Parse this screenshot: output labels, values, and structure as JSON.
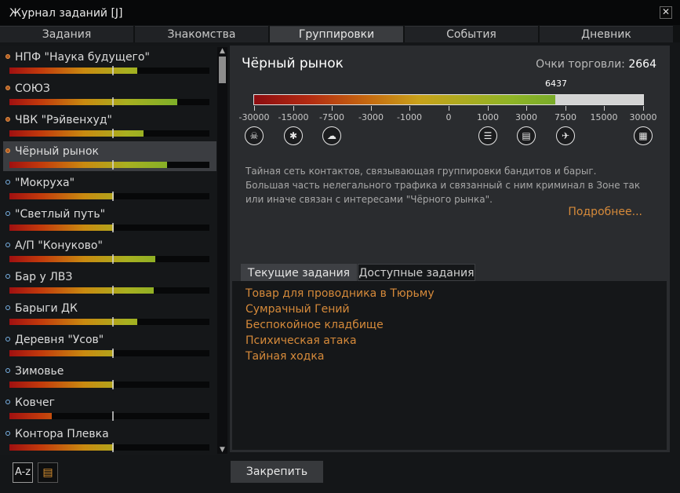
{
  "window": {
    "title": "Журнал заданий [J]",
    "close_icon": "✕"
  },
  "tabs": [
    "Задания",
    "Знакомства",
    "Группировки",
    "События",
    "Дневник"
  ],
  "active_tab": 2,
  "factions": [
    {
      "name": "НПФ \"Наука будущего\"",
      "relation": "hostile",
      "rep_fraction": 0.64
    },
    {
      "name": "СОЮЗ",
      "relation": "hostile",
      "rep_fraction": 0.84
    },
    {
      "name": "ЧВК \"Рэйвенхуд\"",
      "relation": "hostile",
      "rep_fraction": 0.67
    },
    {
      "name": "Чёрный рынок",
      "relation": "hostile",
      "rep_fraction": 0.79,
      "selected": true
    },
    {
      "name": "\"Мокруха\"",
      "relation": "neutral",
      "rep_fraction": 0.52
    },
    {
      "name": "\"Светлый путь\"",
      "relation": "neutral",
      "rep_fraction": 0.52
    },
    {
      "name": "А/П \"Конуково\"",
      "relation": "neutral",
      "rep_fraction": 0.73
    },
    {
      "name": "Бар у ЛВЗ",
      "relation": "neutral",
      "rep_fraction": 0.72
    },
    {
      "name": "Барыги ДК",
      "relation": "neutral",
      "rep_fraction": 0.64
    },
    {
      "name": "Деревня \"Усов\"",
      "relation": "neutral",
      "rep_fraction": 0.52
    },
    {
      "name": "Зимовье",
      "relation": "neutral",
      "rep_fraction": 0.52
    },
    {
      "name": "Ковчег",
      "relation": "neutral",
      "rep_fraction": 0.21
    },
    {
      "name": "Контора Плевка",
      "relation": "neutral",
      "rep_fraction": 0.52
    }
  ],
  "detail": {
    "title": "Чёрный рынок",
    "trade_label": "Очки торговли:",
    "trade_points": "2664",
    "rep_value": "6437",
    "rep_fraction": 0.775,
    "ticks": [
      "-30000",
      "-15000",
      "-7500",
      "-3000",
      "-1000",
      "0",
      "1000",
      "3000",
      "7500",
      "15000",
      "30000"
    ],
    "tick_icons": [
      "skull-icon",
      "bug-icon",
      "ghost-icon",
      "",
      "",
      "",
      "list-icon",
      "clipboard-handshake-icon",
      "running-handshake-icon",
      "",
      "document-icon"
    ],
    "description": "Тайная сеть контактов, связывающая группировки бандитов и барыг. Большая часть нелегального трафика и связанный с ним криминал в Зоне так или иначе связан с интересами \"Чёрного рынка\".",
    "more_link": "Подробнее..."
  },
  "quest_tabs": [
    "Текущие задания",
    "Доступные задания"
  ],
  "quests": [
    "Товар для проводника в Тюрьму",
    "Сумрачный Гений",
    "Беспокойное кладбище",
    "Психическая атака",
    "Тайная ходка"
  ],
  "bottom": {
    "sort_label": "A-z",
    "pin_label": "Закрепить"
  },
  "colors": {
    "accent_orange": "#d68a3a",
    "selected_bg": "#3b3d41"
  }
}
